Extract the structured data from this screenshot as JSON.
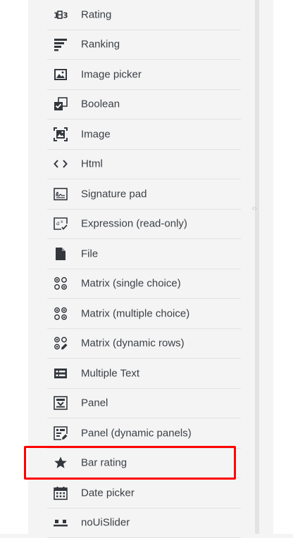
{
  "toolbox": {
    "items": [
      {
        "label": "Rating",
        "icon": "rating-icon"
      },
      {
        "label": "Ranking",
        "icon": "ranking-icon"
      },
      {
        "label": "Image picker",
        "icon": "image-picker-icon"
      },
      {
        "label": "Boolean",
        "icon": "boolean-icon"
      },
      {
        "label": "Image",
        "icon": "image-icon"
      },
      {
        "label": "Html",
        "icon": "html-icon"
      },
      {
        "label": "Signature pad",
        "icon": "signature-pad-icon"
      },
      {
        "label": "Expression (read-only)",
        "icon": "expression-icon"
      },
      {
        "label": "File",
        "icon": "file-icon"
      },
      {
        "label": "Matrix (single choice)",
        "icon": "matrix-single-icon"
      },
      {
        "label": "Matrix (multiple choice)",
        "icon": "matrix-multiple-icon"
      },
      {
        "label": "Matrix (dynamic rows)",
        "icon": "matrix-dynamic-icon"
      },
      {
        "label": "Multiple Text",
        "icon": "multiple-text-icon"
      },
      {
        "label": "Panel",
        "icon": "panel-icon"
      },
      {
        "label": "Panel (dynamic panels)",
        "icon": "panel-dynamic-icon"
      },
      {
        "label": "Bar rating",
        "icon": "star-icon"
      },
      {
        "label": "Date picker",
        "icon": "calendar-icon"
      },
      {
        "label": "noUiSlider",
        "icon": "slider-icon"
      }
    ]
  },
  "splitter": {
    "glyph": "‹›"
  },
  "colors": {
    "icon": "#33373d",
    "highlight": "#ff0000",
    "text": "#3b3f45"
  }
}
